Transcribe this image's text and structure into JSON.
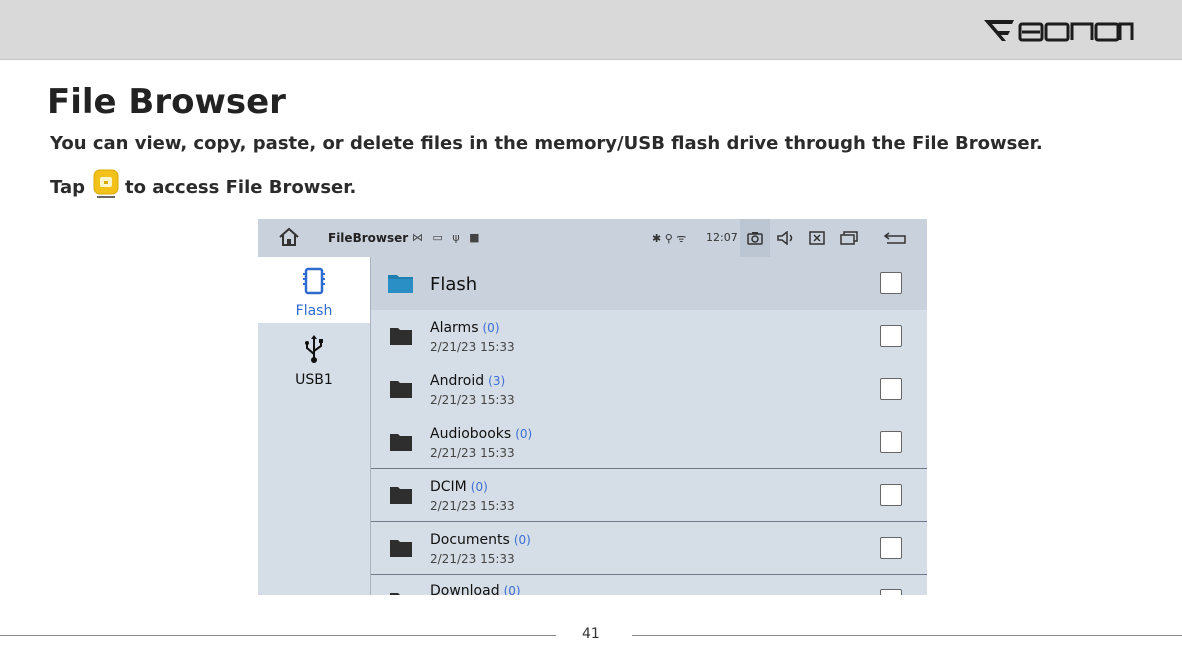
{
  "brand": "Eonon",
  "page_title": "File Browser",
  "intro": "You can view, copy, paste, or delete files in the memory/USB flash drive through the File Browser.",
  "tap": {
    "before": "Tap",
    "after": "to access File Browser.",
    "icon": "file-browser-app-icon"
  },
  "screen": {
    "statusbar": {
      "app_name": "FileBrowser",
      "time": "12:07",
      "icons": [
        "home-icon",
        "camera-icon",
        "volume-icon",
        "close-window-icon",
        "multiwindow-icon",
        "back-icon"
      ]
    },
    "sidebar": [
      {
        "label": "Flash",
        "icon": "memory-chip-icon",
        "active": true
      },
      {
        "label": "USB1",
        "icon": "usb-icon",
        "active": false
      }
    ],
    "current_folder": "Flash",
    "files": [
      {
        "name": "Alarms",
        "count": "(0)",
        "date": "2/21/23 15:33"
      },
      {
        "name": "Android",
        "count": "(3)",
        "date": "2/21/23 15:33"
      },
      {
        "name": "Audiobooks",
        "count": "(0)",
        "date": "2/21/23 15:33"
      },
      {
        "name": "DCIM",
        "count": "(0)",
        "date": "2/21/23 15:33"
      },
      {
        "name": "Documents",
        "count": "(0)",
        "date": "2/21/23 15:33"
      },
      {
        "name": "Download",
        "count": "(0)",
        "date": ""
      }
    ]
  },
  "page_number": "41",
  "colors": {
    "accent": "#3b6fd4",
    "folder_header": "#1f7fb0",
    "folder": "#2e2e2e"
  }
}
